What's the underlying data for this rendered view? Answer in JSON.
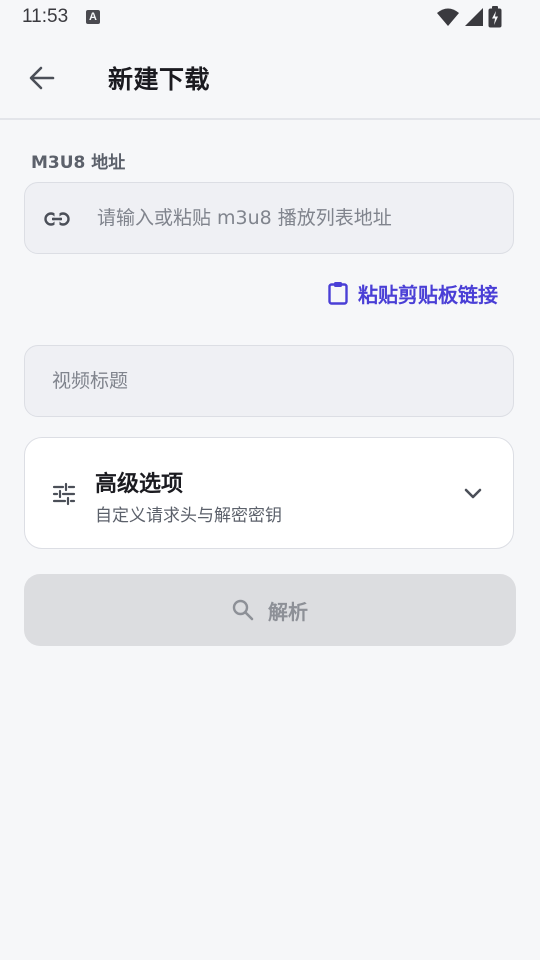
{
  "status_bar": {
    "time": "11:53",
    "notification_icon": "a-icon",
    "notification_glyph": "A",
    "icons": [
      "wifi-icon",
      "signal-icon",
      "battery-charging-icon"
    ]
  },
  "app_bar": {
    "back_icon": "arrow-left-icon",
    "title": "新建下载"
  },
  "form": {
    "url_section_label": "M3U8 地址",
    "url_input": {
      "icon": "link-icon",
      "value": "",
      "placeholder": "请输入或粘贴 m3u8 播放列表地址"
    },
    "paste_button": {
      "icon": "clipboard-icon",
      "label": "粘贴剪贴板链接"
    },
    "title_input": {
      "value": "",
      "placeholder": "视频标题"
    },
    "advanced": {
      "icon": "tune-icon",
      "title": "高级选项",
      "subtitle": "自定义请求头与解密密钥",
      "expand_icon": "chevron-down-icon"
    },
    "parse_button": {
      "icon": "search-icon",
      "label": "解析",
      "enabled": false
    }
  },
  "colors": {
    "background": "#f6f7f9",
    "accent": "#4a3fd6",
    "field_background": "#eff0f4",
    "disabled_button": "#dcdde0",
    "disabled_text": "#8d9097"
  }
}
